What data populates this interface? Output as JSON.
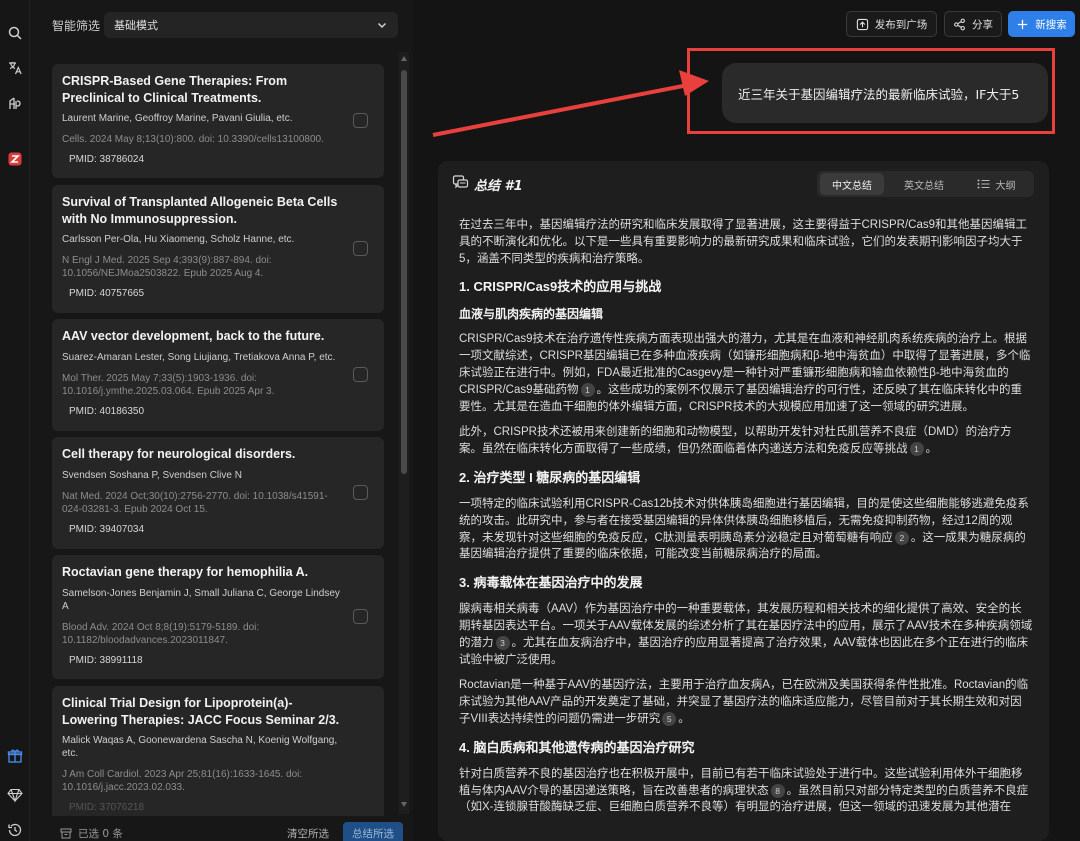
{
  "filter": {
    "label": "智能筛选",
    "mode": "基础模式"
  },
  "articles": [
    {
      "title": "CRISPR-Based Gene Therapies: From Preclinical to Clinical Treatments.",
      "authors": "Laurent Marine, Geoffroy Marine, Pavani Giulia, etc.",
      "journal": "Cells. 2024 May 8;13(10):800. doi: 10.3390/cells13100800.",
      "pmid": "PMID: 38786024"
    },
    {
      "title": "Survival of Transplanted Allogeneic Beta Cells with No Immunosuppression.",
      "authors": "Carlsson Per-Ola, Hu Xiaomeng, Scholz Hanne, etc.",
      "journal": "N Engl J Med. 2025 Sep 4;393(9):887-894. doi: 10.1056/NEJMoa2503822. Epub 2025 Aug 4.",
      "pmid": "PMID: 40757665"
    },
    {
      "title": "AAV vector development, back to the future.",
      "authors": "Suarez-Amaran Lester, Song Liujiang, Tretiakova Anna P, etc.",
      "journal": "Mol Ther. 2025 May 7;33(5):1903-1936. doi: 10.1016/j.ymthe.2025.03.064. Epub 2025 Apr 3.",
      "pmid": "PMID: 40186350"
    },
    {
      "title": "Cell therapy for neurological disorders.",
      "authors": "Svendsen Soshana P, Svendsen Clive N",
      "journal": "Nat Med. 2024 Oct;30(10):2756-2770. doi: 10.1038/s41591-024-03281-3. Epub 2024 Oct 15.",
      "pmid": "PMID: 39407034"
    },
    {
      "title": "Roctavian gene therapy for hemophilia A.",
      "authors": "Samelson-Jones Benjamin J, Small Juliana C, George Lindsey A",
      "journal": "Blood Adv. 2024 Oct 8;8(19):5179-5189. doi: 10.1182/bloodadvances.2023011847.",
      "pmid": "PMID: 38991118"
    },
    {
      "title": "Clinical Trial Design for Lipoprotein(a)-Lowering Therapies: JACC Focus Seminar 2/3.",
      "authors": "Malick Waqas A, Goonewardena Sascha N, Koenig Wolfgang, etc.",
      "journal": "J Am Coll Cardiol. 2023 Apr 25;81(16):1633-1645. doi: 10.1016/j.jacc.2023.02.033.",
      "pmid": "PMID: 37076218"
    }
  ],
  "bottom": {
    "selected": "已选 0 条",
    "clear": "清空所选",
    "summarize": "总结所选"
  },
  "topbar": {
    "publish": "发布到广场",
    "share": "分享",
    "new_search": "新搜索"
  },
  "query": "近三年关于基因编辑疗法的最新临床试验，IF大于5",
  "summary": {
    "title": "总结 #1",
    "tabs": {
      "cn": "中文总结",
      "en": "英文总结",
      "outline": "大纲"
    },
    "intro": "在过去三年中，基因编辑疗法的研究和临床发展取得了显著进展，这主要得益于CRISPR/Cas9和其他基因编辑工具的不断演化和优化。以下是一些具有重要影响力的最新研究成果和临床试验，它们的发表期刊影响因子均大于5，涵盖不同类型的疾病和治疗策略。",
    "s1": "1. CRISPR/Cas9技术的应用与挑战",
    "s1_sub": "血液与肌肉疾病的基因编辑",
    "s1_p1a": "CRISPR/Cas9技术在治疗遗传性疾病方面表现出强大的潜力，尤其是在血液和神经肌肉系统疾病的治疗上。根据一项文献综述，CRISPR基因编辑已在多种血液疾病（如镰形细胞病和β-地中海贫血）中取得了显著进展，多个临床试验正在进行中。例如，FDA最近批准的Casgevy是一种针对严重镰形细胞病和输血依赖性β-地中海贫血的CRISPR/Cas9基础药物",
    "s1_p1b": "。这些成功的案例不仅展示了基因编辑治疗的可行性，还反映了其在临床转化中的重要性。尤其是在造血干细胞的体外编辑方面，CRISPR技术的大规模应用加速了这一领域的研究进展。",
    "s1_p2a": "此外，CRISPR技术还被用来创建新的细胞和动物模型，以帮助开发针对杜氏肌营养不良症（DMD）的治疗方案。虽然在临床转化方面取得了一些成绩，但仍然面临着体内递送方法和免疫反应等挑战",
    "s1_p2b": "。",
    "s2": "2. 治疗类型 I 糖尿病的基因编辑",
    "s2_pa": "一项特定的临床试验利用CRISPR-Cas12b技术对供体胰岛细胞进行基因编辑，目的是使这些细胞能够逃避免疫系统的攻击。此研究中，参与者在接受基因编辑的异体供体胰岛细胞移植后，无需免疫抑制药物，经过12周的观察，未发现针对这些细胞的免疫反应，C肽测量表明胰岛素分泌稳定且对葡萄糖有响应",
    "s2_pb": "。这一成果为糖尿病的基因编辑治疗提供了重要的临床依据，可能改变当前糖尿病治疗的局面。",
    "s3": "3. 病毒载体在基因治疗中的发展",
    "s3_p1a": "腺病毒相关病毒（AAV）作为基因治疗中的一种重要载体，其发展历程和相关技术的细化提供了高效、安全的长期转基因表达平台。一项关于AAV载体发展的综述分析了其在基因疗法中的应用，展示了AAV技术在多种疾病领域的潜力",
    "s3_p1b": "。尤其在血友病治疗中，基因治疗的应用显著提高了治疗效果，AAV载体也因此在多个正在进行的临床试验中被广泛使用。",
    "s3_p2a": "Roctavian是一种基于AAV的基因疗法，主要用于治疗血友病A，已在欧洲及美国获得条件性批准。Roctavian的临床试验为其他AAV产品的开发奠定了基础，并突显了基因疗法的临床适应能力，尽管目前对于其长期生效和对因子VIII表达持续性的问题仍需进一步研究",
    "s3_p2b": "。",
    "s4": "4. 脑白质病和其他遗传病的基因治疗研究",
    "s4_pa": "针对白质营养不良的基因治疗也在积极开展中，目前已有若干临床试验处于进行中。这些试验利用体外干细胞移植与体内AAV介导的基因递送策略，旨在改善患者的病理状态",
    "s4_pb": "。虽然目前只对部分特定类型的白质营养不良症（如X-连锁腺苷酸酶缺乏症、巨细胞白质营养不良等）有明显的治疗进展，但这一领域的迅速发展为其他潜在",
    "cites": [
      "1",
      "1",
      "2",
      "3",
      "5",
      "8"
    ]
  }
}
